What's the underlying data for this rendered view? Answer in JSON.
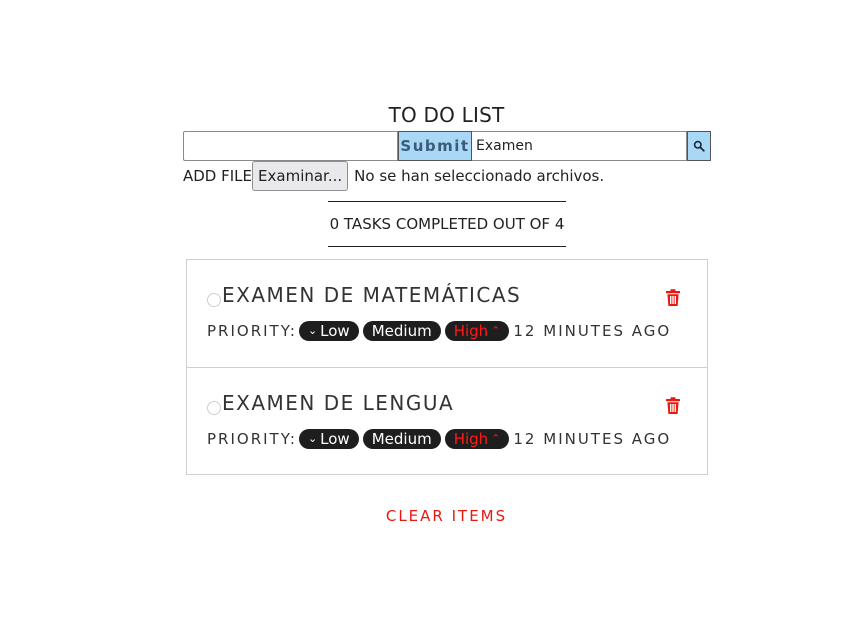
{
  "app": {
    "title": "TO DO LIST"
  },
  "form": {
    "task_input_value": "",
    "submit_label": "Submit",
    "search_value": "Examen",
    "search_icon": "magnifier-icon"
  },
  "file": {
    "label": "ADD FILE",
    "button_label": "Examinar...",
    "status": "No se han seleccionado archivos."
  },
  "counter": {
    "text": "0 TASKS COMPLETED OUT OF 4"
  },
  "tasks": [
    {
      "name": "EXAMEN DE MATEMÁTICAS",
      "completed": false,
      "priority_label": "PRIORITY:",
      "priorities": [
        "Low",
        "Medium",
        "High"
      ],
      "selected_priority": "High",
      "time": "12 MINUTES AGO"
    },
    {
      "name": "EXAMEN DE LENGUA",
      "completed": false,
      "priority_label": "PRIORITY:",
      "priorities": [
        "Low",
        "Medium",
        "High"
      ],
      "selected_priority": "High",
      "time": "12 MINUTES AGO"
    }
  ],
  "footer": {
    "clear_label": "CLEAR ITEMS"
  },
  "colors": {
    "accent_button": "#a9d7f6",
    "pill_background": "#1e1e1e",
    "priority_active": "#ff1a1a",
    "danger": "#e8190f"
  },
  "icons": {
    "delete": "trash-icon",
    "low_chevron": "chevron-down-icon",
    "high_chevron": "chevron-up-icon"
  }
}
